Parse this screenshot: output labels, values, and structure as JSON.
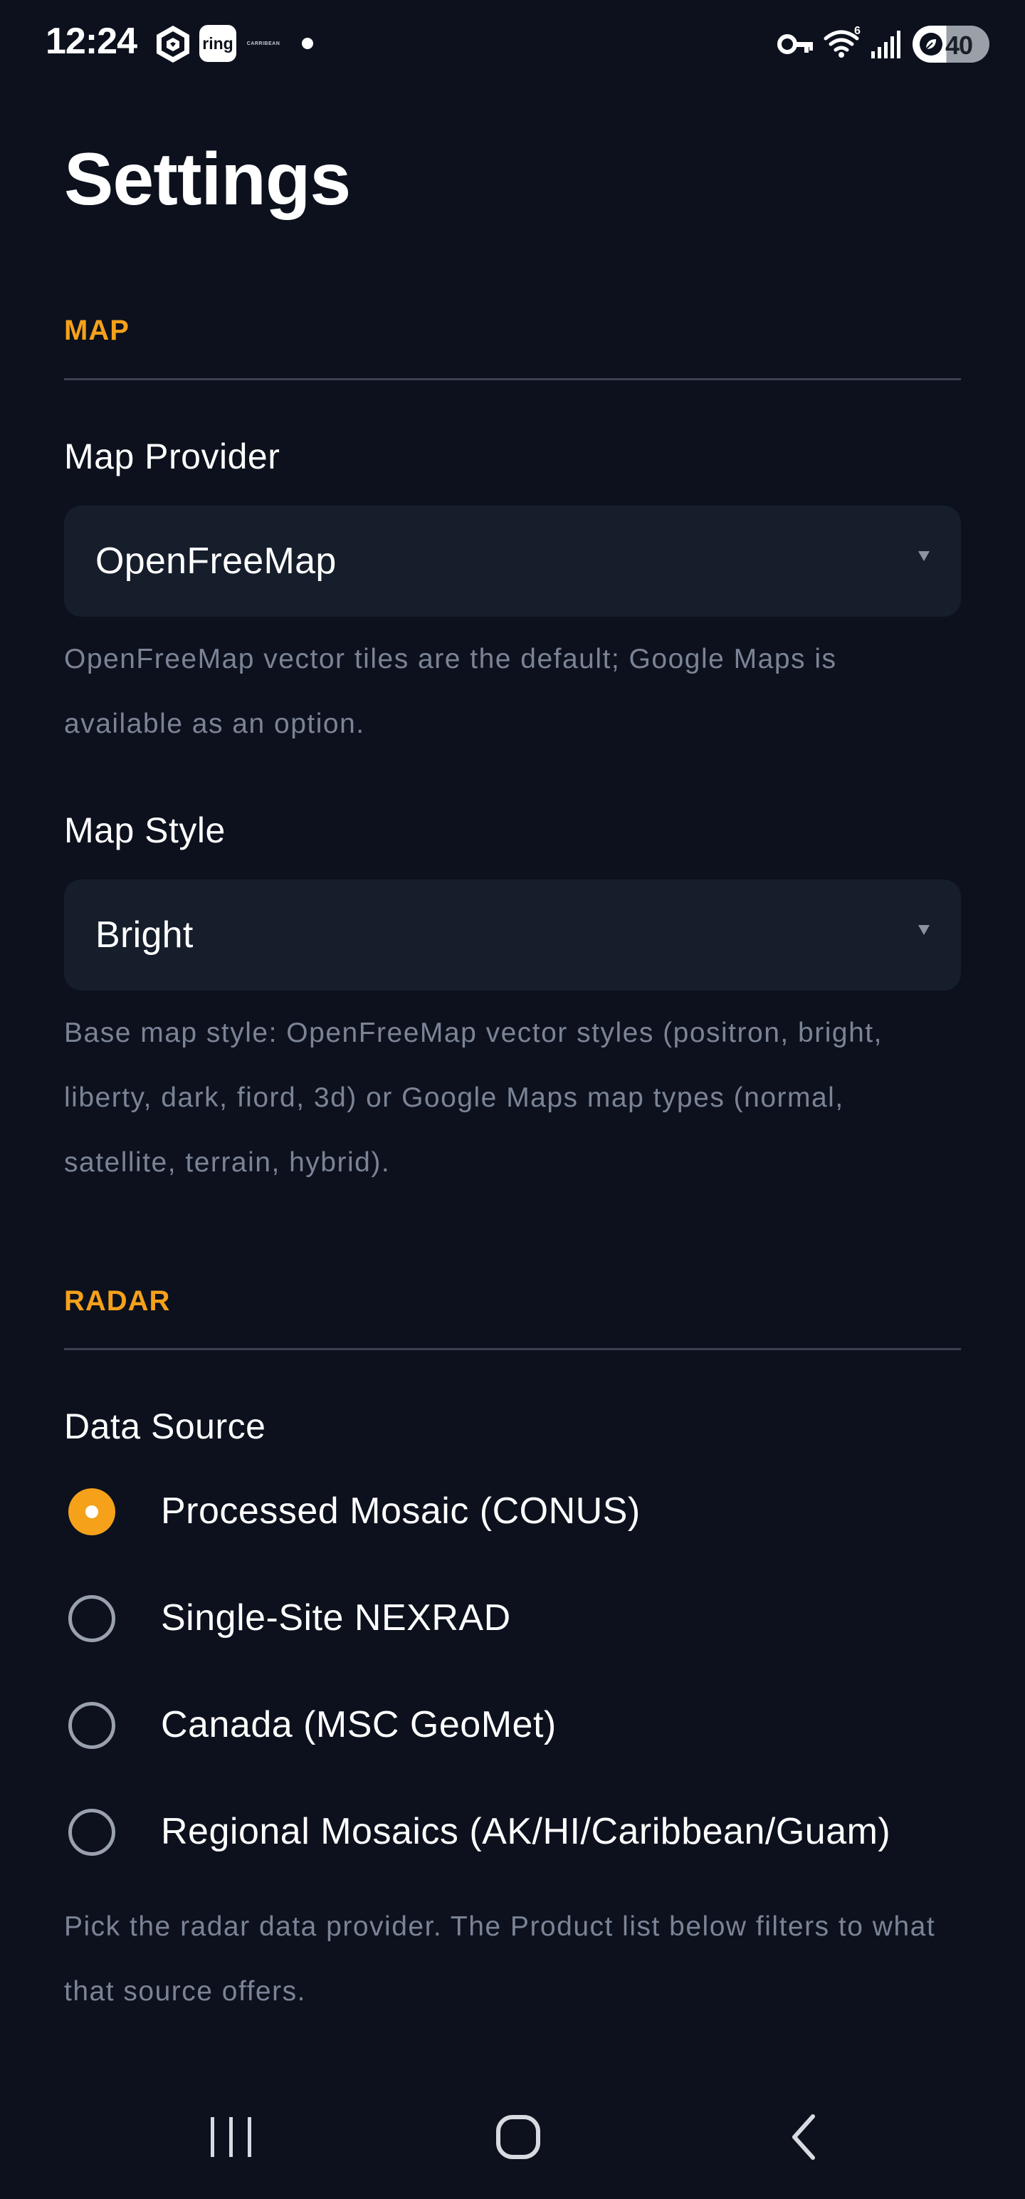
{
  "status_bar": {
    "time": "12:24",
    "apps": [
      "brand-app-icon",
      "ring-app-icon",
      "small-app-icon"
    ],
    "ring_label": "ring",
    "tiny_label": "CARRIBEAN",
    "battery_level": "40"
  },
  "page": {
    "title": "Settings"
  },
  "sections": {
    "map": {
      "header": "MAP",
      "provider": {
        "label": "Map Provider",
        "value": "OpenFreeMap",
        "help": "OpenFreeMap vector tiles are the default; Google Maps is available as an option."
      },
      "style": {
        "label": "Map Style",
        "value": "Bright",
        "help": "Base map style: OpenFreeMap vector styles (positron, bright, liberty, dark, fiord, 3d) or Google Maps map types (normal, satellite, terrain, hybrid)."
      }
    },
    "radar": {
      "header": "RADAR",
      "data_source": {
        "label": "Data Source",
        "selected_index": 0,
        "options": [
          {
            "label": "Processed Mosaic (CONUS)"
          },
          {
            "label": "Single-Site NEXRAD"
          },
          {
            "label": "Canada (MSC GeoMet)"
          },
          {
            "label": "Regional Mosaics (AK/HI/Caribbean/Guam)"
          }
        ],
        "help": "Pick the radar data provider. The Product list below filters to what that source offers."
      }
    }
  },
  "nav_bar": {
    "buttons": [
      "recents-icon",
      "home-icon",
      "back-icon"
    ]
  },
  "colors": {
    "background": "#0c111d",
    "accent": "#f5a11a",
    "field_background": "#161d2b",
    "help_text": "#7b8496"
  }
}
